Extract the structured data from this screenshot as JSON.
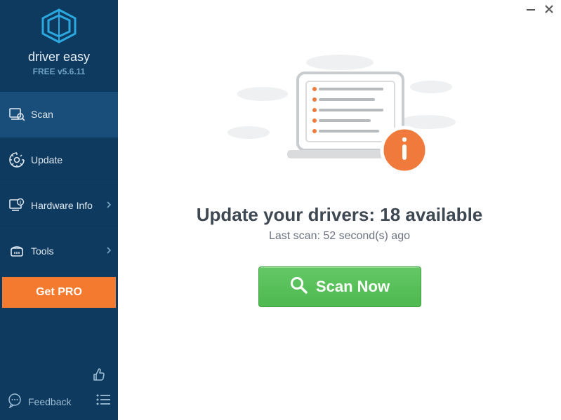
{
  "app": {
    "brand": "driver easy",
    "version": "FREE v5.6.11"
  },
  "sidebar": {
    "items": [
      {
        "label": "Scan"
      },
      {
        "label": "Update"
      },
      {
        "label": "Hardware Info"
      },
      {
        "label": "Tools"
      }
    ],
    "get_pro_label": "Get PRO",
    "feedback_label": "Feedback"
  },
  "main": {
    "headline_prefix": "Update your drivers: ",
    "available_count": "18",
    "headline_suffix": " available",
    "last_scan": "Last scan: 52 second(s) ago",
    "scan_button": "Scan Now"
  },
  "colors": {
    "sidebar_bg": "#0e3a5f",
    "sidebar_active": "#1a4e7a",
    "accent_orange": "#f47a30",
    "accent_green": "#55bf55",
    "info_orange": "#f07a3c"
  }
}
